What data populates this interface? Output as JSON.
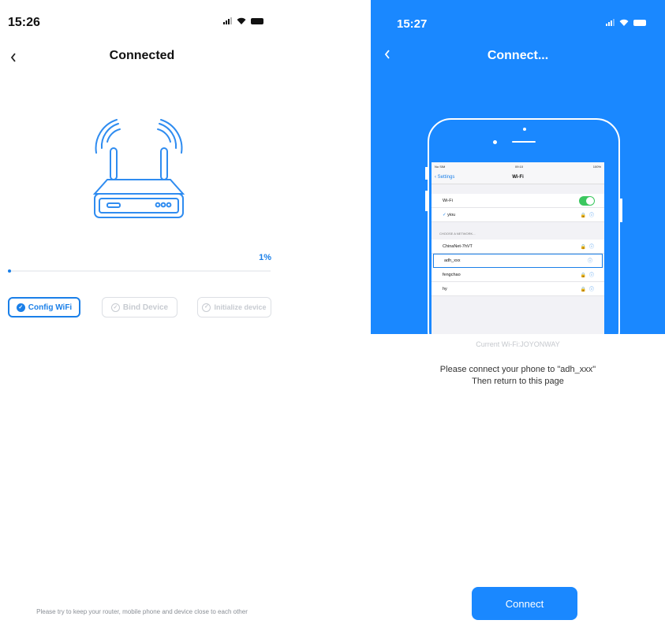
{
  "left": {
    "status_time": "15:26",
    "title": "Connected",
    "progress_label": "1%",
    "progress_fraction": 0.01,
    "steps": [
      {
        "label": "Config WiFi",
        "state": "active"
      },
      {
        "label": "Bind Device",
        "state": "pending"
      },
      {
        "label": "Initialize device",
        "state": "pending"
      }
    ],
    "footer": "Please try to keep your router, mobile phone and device close to each other",
    "icons": {
      "back": "chevron-left-icon",
      "router": "router-icon"
    }
  },
  "right": {
    "status_time": "15:27",
    "title": "Connect...",
    "phone_screen": {
      "status_left": "No SIM",
      "status_time": "09:10",
      "status_right": "100%",
      "back_label": "Settings",
      "screen_title": "Wi-Fi",
      "wifi_row_label": "Wi-Fi",
      "connected_network": "yiou",
      "section_header": "CHOOSE A NETWORK...",
      "networks": [
        "ChinaNet-7hVT",
        "adh_xxx",
        "fengchao",
        "hy"
      ]
    },
    "current_wifi": "Current Wi-Fi:JOYONWAY",
    "instruction_line1": "Please connect your phone to \"adh_xxx\"",
    "instruction_line2": "Then return to this page",
    "connect_button": "Connect"
  },
  "colors": {
    "accent": "#1a88ff",
    "progress": "#1a7fe8",
    "inactive": "#c7cbd1",
    "toggle_on": "#3bc75f"
  }
}
